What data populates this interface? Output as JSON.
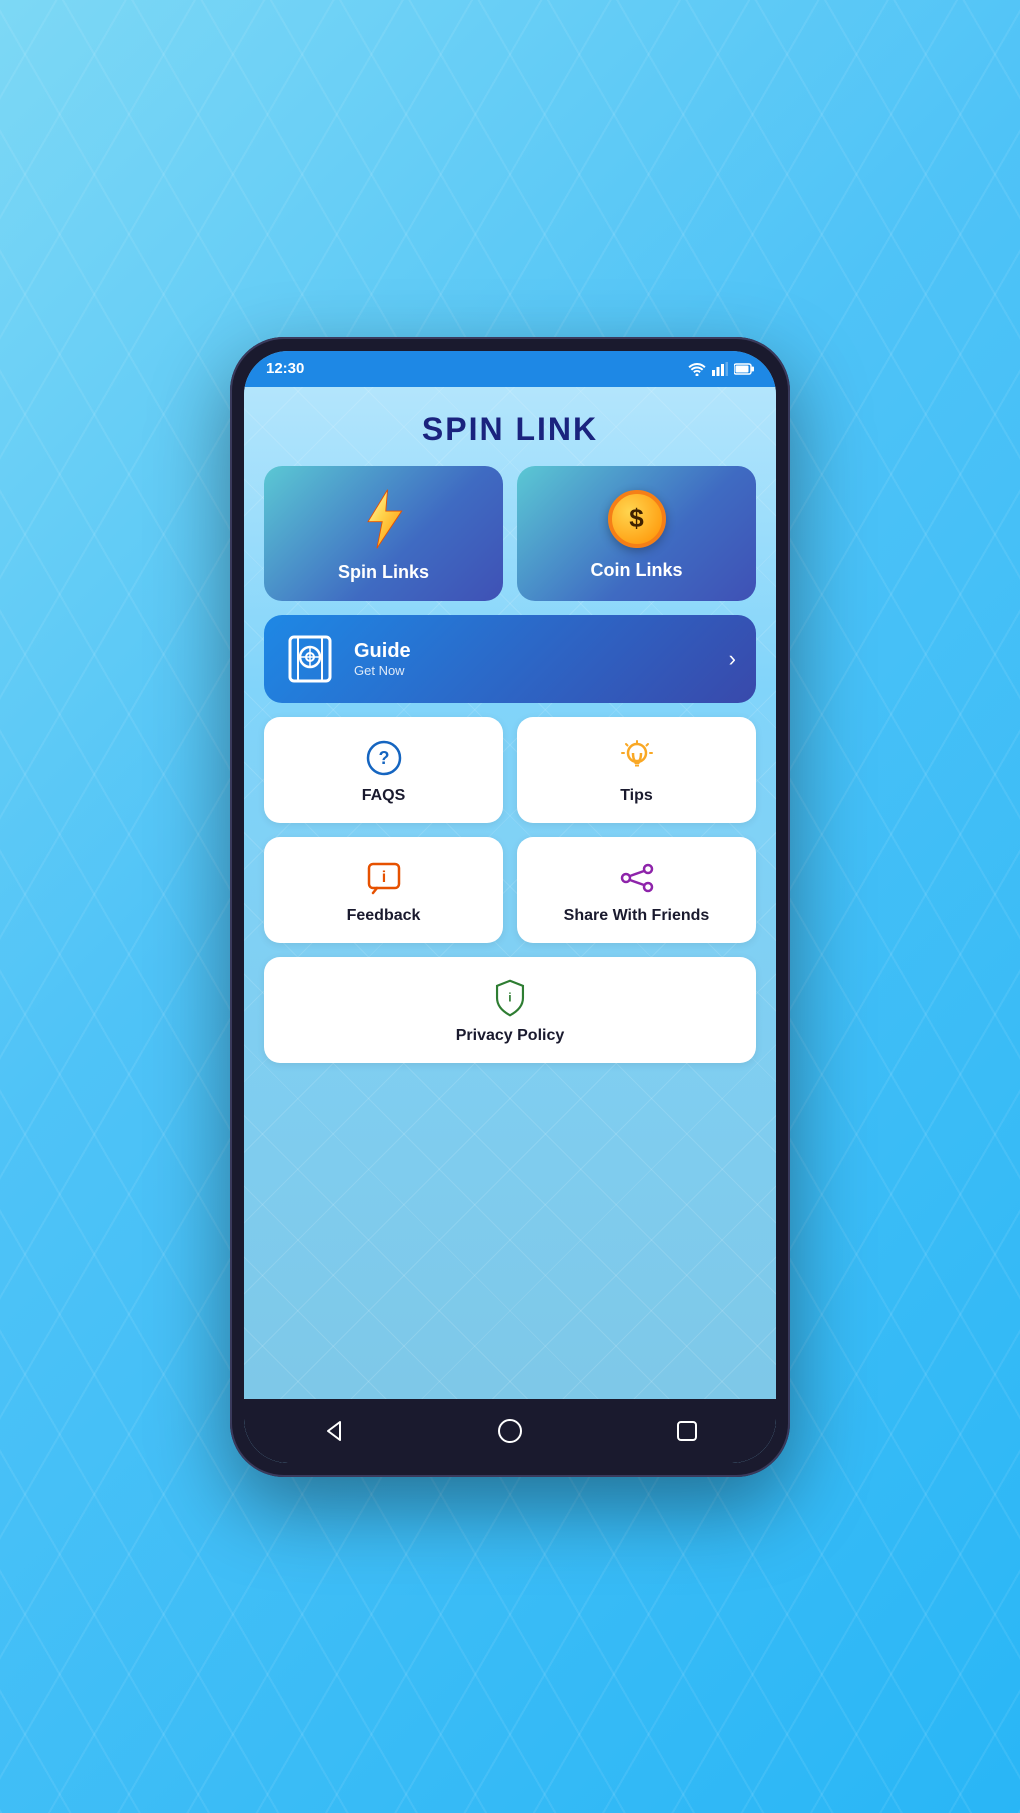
{
  "statusBar": {
    "time": "12:30"
  },
  "app": {
    "title": "SPIN LINK",
    "spinLinks": {
      "label": "Spin Links"
    },
    "coinLinks": {
      "label": "Coin Links"
    },
    "guide": {
      "title": "Guide",
      "subtitle": "Get Now"
    },
    "faqs": {
      "label": "FAQS"
    },
    "tips": {
      "label": "Tips"
    },
    "feedback": {
      "label": "Feedback"
    },
    "shareWithFriends": {
      "label": "Share With Friends"
    },
    "privacyPolicy": {
      "label": "Privacy Policy"
    }
  },
  "navBar": {
    "back": "◁",
    "home": "○",
    "recent": "□"
  }
}
